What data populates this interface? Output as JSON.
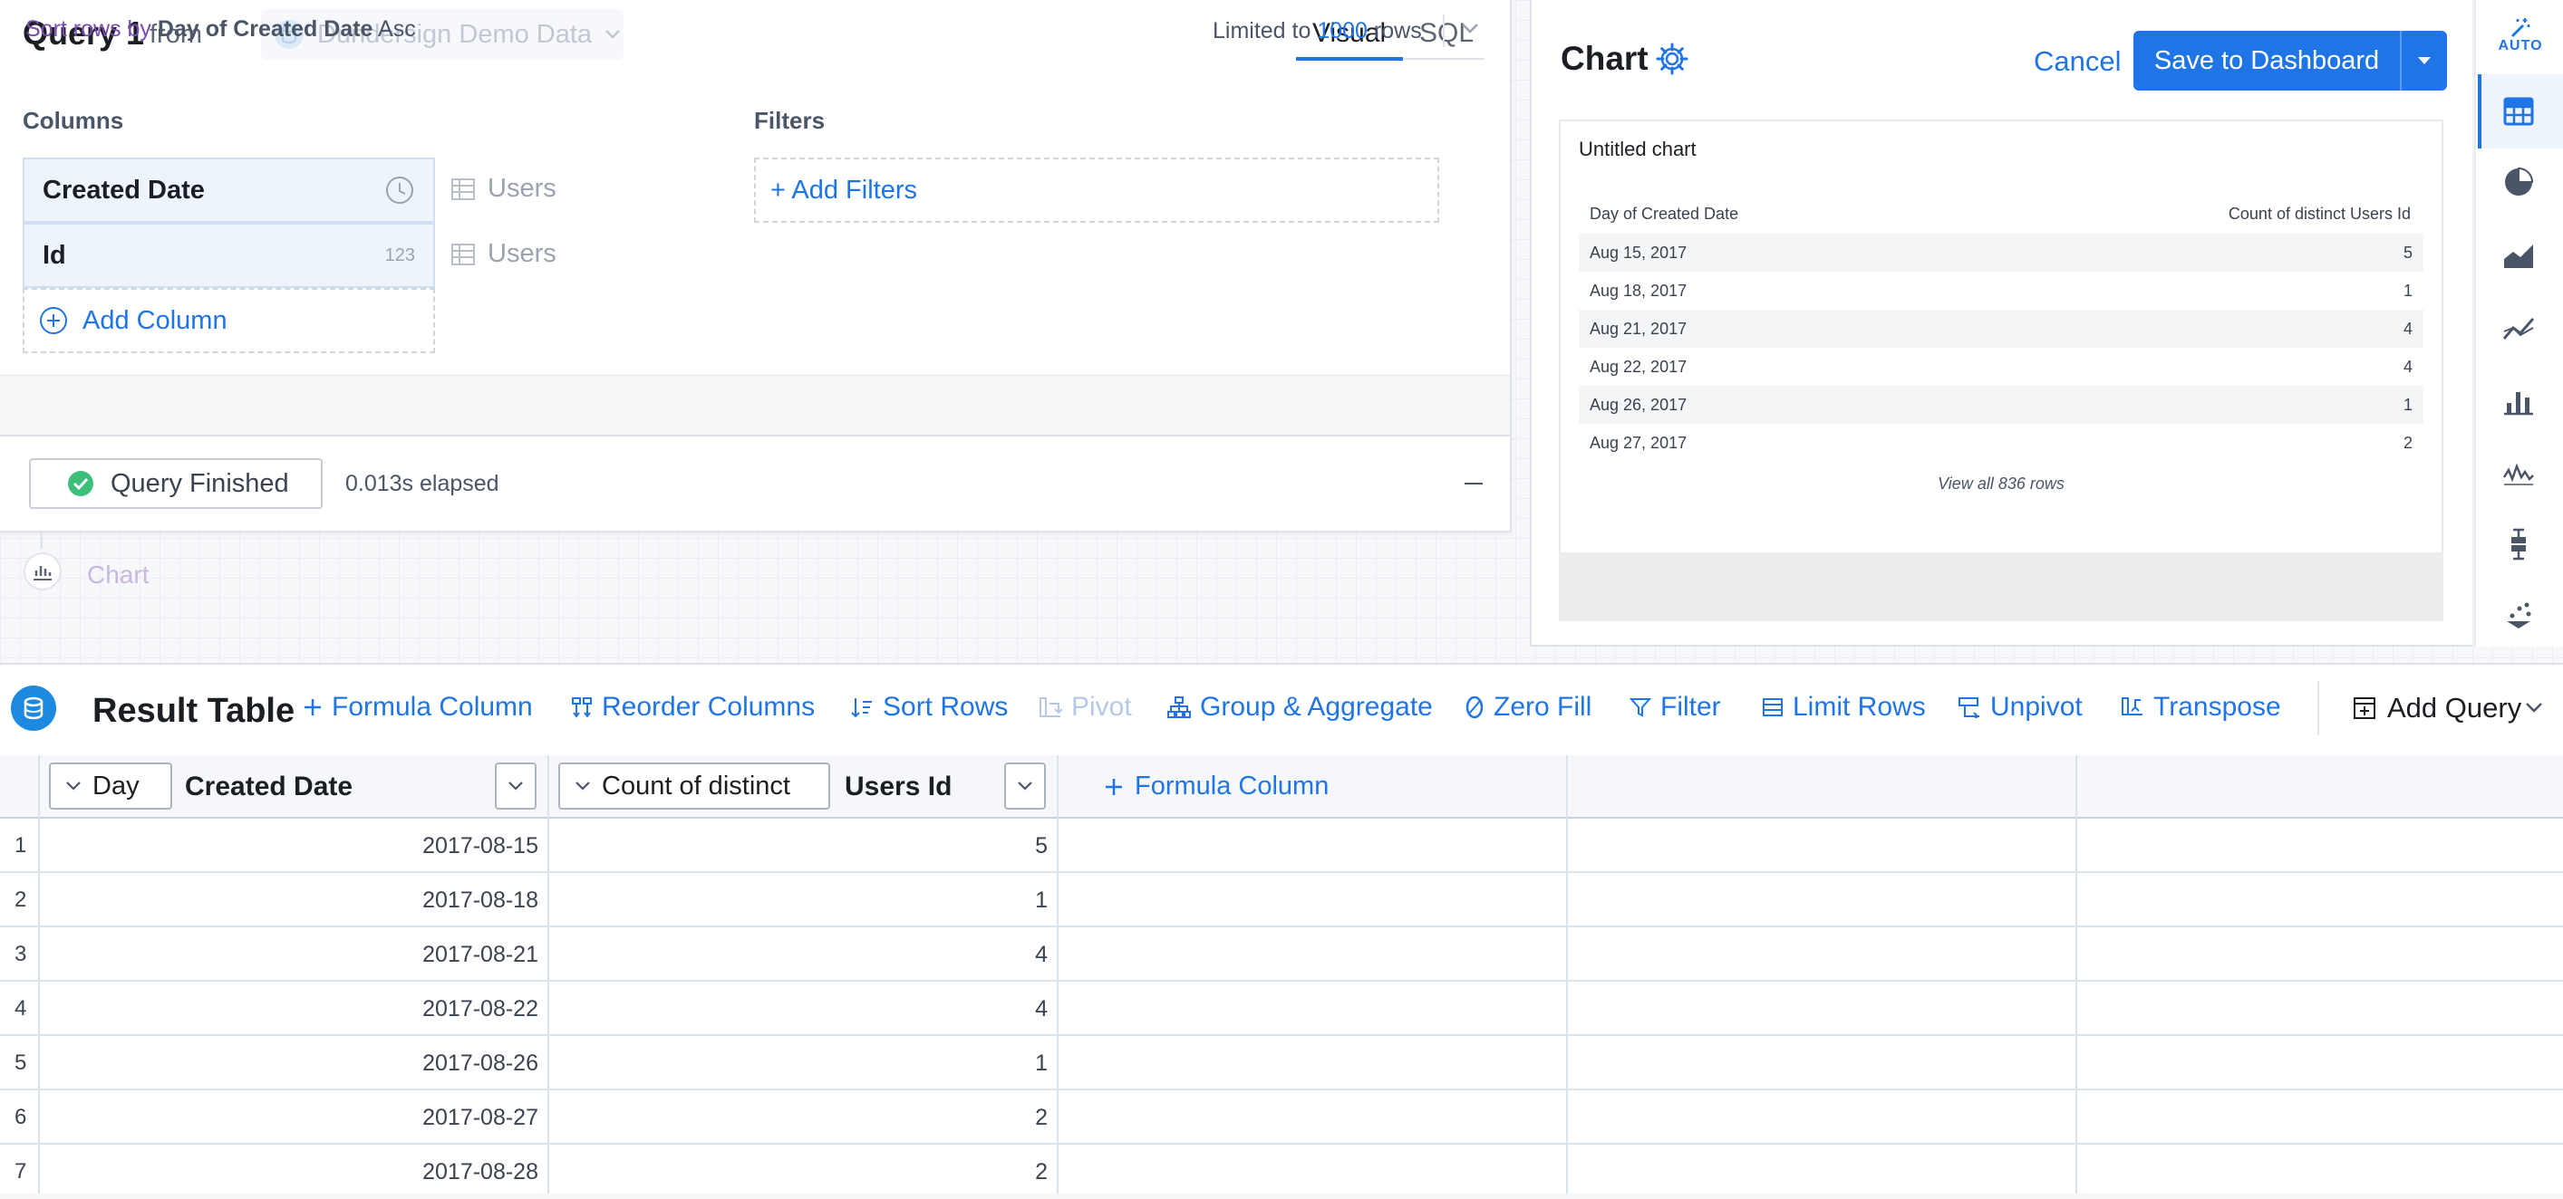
{
  "query": {
    "title": "Query 1",
    "from_label": "from",
    "source": "Dundersign Demo Data",
    "tabs": {
      "visual": "Visual",
      "sql": "SQL"
    },
    "columns_label": "Columns",
    "filters_label": "Filters",
    "columns": [
      {
        "name": "Created Date",
        "type_icon": "clock-icon",
        "table": "Users"
      },
      {
        "name": "Id",
        "type_badge": "123",
        "table": "Users"
      }
    ],
    "add_column": "Add Column",
    "add_filters": "+ Add Filters",
    "sort": {
      "prefix": "Sort rows by",
      "field": "Day of Created Date",
      "direction": "Asc"
    },
    "limit": {
      "prefix": "Limited to",
      "value": "1000",
      "suffix": "rows"
    },
    "status": "Query Finished",
    "elapsed": "0.013s elapsed",
    "chart_node": "Chart"
  },
  "chart_panel": {
    "title": "Chart",
    "cancel": "Cancel",
    "save": "Save to Dashboard",
    "preview_title": "Untitled chart",
    "headers": [
      "Day of Created Date",
      "Count of distinct Users Id"
    ],
    "rows": [
      [
        "Aug 15, 2017",
        "5"
      ],
      [
        "Aug 18, 2017",
        "1"
      ],
      [
        "Aug 21, 2017",
        "4"
      ],
      [
        "Aug 22, 2017",
        "4"
      ],
      [
        "Aug 26, 2017",
        "1"
      ],
      [
        "Aug 27, 2017",
        "2"
      ]
    ],
    "view_all": "View all 836 rows",
    "auto_label": "AUTO"
  },
  "toolbar": {
    "title": "Result Table",
    "formula_column": "Formula Column",
    "reorder_columns": "Reorder Columns",
    "sort_rows": "Sort Rows",
    "pivot": "Pivot",
    "group_aggregate": "Group & Aggregate",
    "zero_fill": "Zero Fill",
    "filter": "Filter",
    "limit_rows": "Limit Rows",
    "unpivot": "Unpivot",
    "transpose": "Transpose",
    "add_query": "Add Query"
  },
  "result_table": {
    "col1": {
      "agg": "Day",
      "label": "Created Date"
    },
    "col2": {
      "agg": "Count of distinct",
      "label": "Users Id"
    },
    "formula_column": "Formula Column",
    "rows": [
      {
        "n": "1",
        "date": "2017-08-15",
        "count": "5"
      },
      {
        "n": "2",
        "date": "2017-08-18",
        "count": "1"
      },
      {
        "n": "3",
        "date": "2017-08-21",
        "count": "4"
      },
      {
        "n": "4",
        "date": "2017-08-22",
        "count": "4"
      },
      {
        "n": "5",
        "date": "2017-08-26",
        "count": "1"
      },
      {
        "n": "6",
        "date": "2017-08-27",
        "count": "2"
      },
      {
        "n": "7",
        "date": "2017-08-28",
        "count": "2"
      }
    ]
  },
  "colors": {
    "accent": "#1f75e6",
    "success": "#3bbf7a",
    "sort_prefix": "#7a4bb0"
  }
}
